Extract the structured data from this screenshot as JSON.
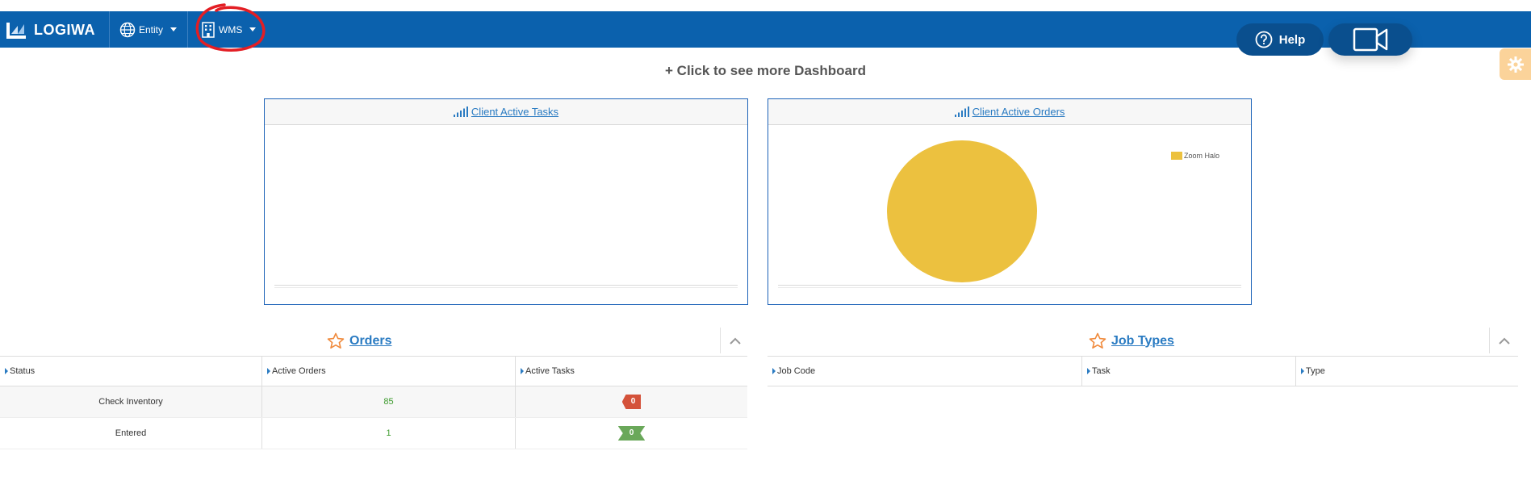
{
  "topbar": {
    "logo_text": "LOGIWA",
    "entity_label": "Entity",
    "wms_label": "WMS",
    "help_label": "Help"
  },
  "dashboard_link": "+ Click to see more Dashboard",
  "panels": {
    "tasks_title": "Client Active Tasks",
    "orders_title": "Client Active Orders"
  },
  "chart_data": {
    "type": "pie",
    "title": "Client Active Orders",
    "slices": [
      {
        "label": "Zoom Halo",
        "value": 100,
        "color": "#ecc13f"
      }
    ]
  },
  "orders": {
    "title": "Orders",
    "columns": [
      "Status",
      "Active Orders",
      "Active Tasks"
    ],
    "rows": [
      {
        "status": "Check Inventory",
        "active_orders": "85",
        "active_tasks": "0",
        "badge": "red"
      },
      {
        "status": "Entered",
        "active_orders": "1",
        "active_tasks": "0",
        "badge": "green"
      }
    ]
  },
  "job_types": {
    "title": "Job Types",
    "columns": [
      "Job Code",
      "Task",
      "Type"
    ]
  },
  "colors": {
    "topbar": "#0b61ad",
    "accent_link": "#2a7bc2",
    "annotation": "#e31e24",
    "pie": "#ecc13f"
  }
}
